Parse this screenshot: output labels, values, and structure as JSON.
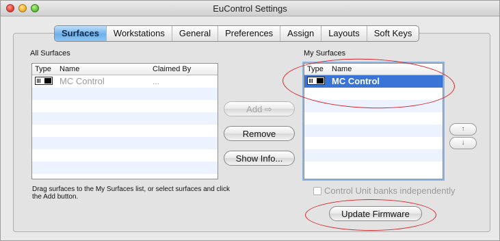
{
  "window": {
    "title": "EuControl Settings"
  },
  "tabs": [
    {
      "label": "Surfaces",
      "active": true
    },
    {
      "label": "Workstations",
      "active": false
    },
    {
      "label": "General",
      "active": false
    },
    {
      "label": "Preferences",
      "active": false
    },
    {
      "label": "Assign",
      "active": false
    },
    {
      "label": "Layouts",
      "active": false
    },
    {
      "label": "Soft Keys",
      "active": false
    }
  ],
  "all_surfaces": {
    "label": "All Surfaces",
    "columns": {
      "type": "Type",
      "name": "Name",
      "claimed_by": "Claimed By"
    },
    "rows": [
      {
        "icon": "mc-control-device-icon",
        "name": "MC Control",
        "claimed_by": "..."
      }
    ]
  },
  "my_surfaces": {
    "label": "My Surfaces",
    "columns": {
      "type": "Type",
      "name": "Name"
    },
    "rows": [
      {
        "icon": "mc-control-device-icon",
        "name": "MC Control",
        "selected": true
      }
    ]
  },
  "buttons": {
    "add": "Add ⇨",
    "remove": "Remove",
    "show_info": "Show Info...",
    "update_firmware": "Update Firmware",
    "move_up_icon": "↑",
    "move_down_icon": "↓"
  },
  "hint_text": "Drag surfaces to the My Surfaces list, or select surfaces and click the Add button.",
  "checkbox": {
    "label": "Control Unit banks independently",
    "checked": false,
    "enabled": false
  },
  "colors": {
    "selection": "#3875d7",
    "active_tab": "#6eb0ea",
    "annotation": "#d9242a"
  }
}
